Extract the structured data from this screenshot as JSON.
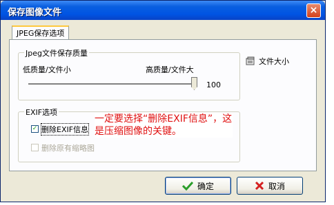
{
  "window": {
    "title": "保存图像文件",
    "close_glyph": "×"
  },
  "tab": {
    "label": "JPEG保存选项"
  },
  "quality_group": {
    "legend": "Jpeg文件保存质量",
    "low_label": "低质量/文件小",
    "high_label": "高质量/文件大",
    "value": "100",
    "file_size_label": "文件大小"
  },
  "exif_group": {
    "legend": "EXIF选项",
    "remove_exif_label": "删除EXIF信息",
    "remove_exif_checked": true,
    "remove_thumbnail_label": "删除原有缩略图",
    "remove_thumbnail_checked": false
  },
  "annotation": {
    "text": "一定要选择“删除EXIF信息”，这是压缩图像的关键。"
  },
  "buttons": {
    "ok_label": "确定",
    "cancel_label": "取消"
  },
  "colors": {
    "title_bar": "#0054e3",
    "annotation": "#e01010",
    "dialog_bg": "#ece9d8"
  }
}
